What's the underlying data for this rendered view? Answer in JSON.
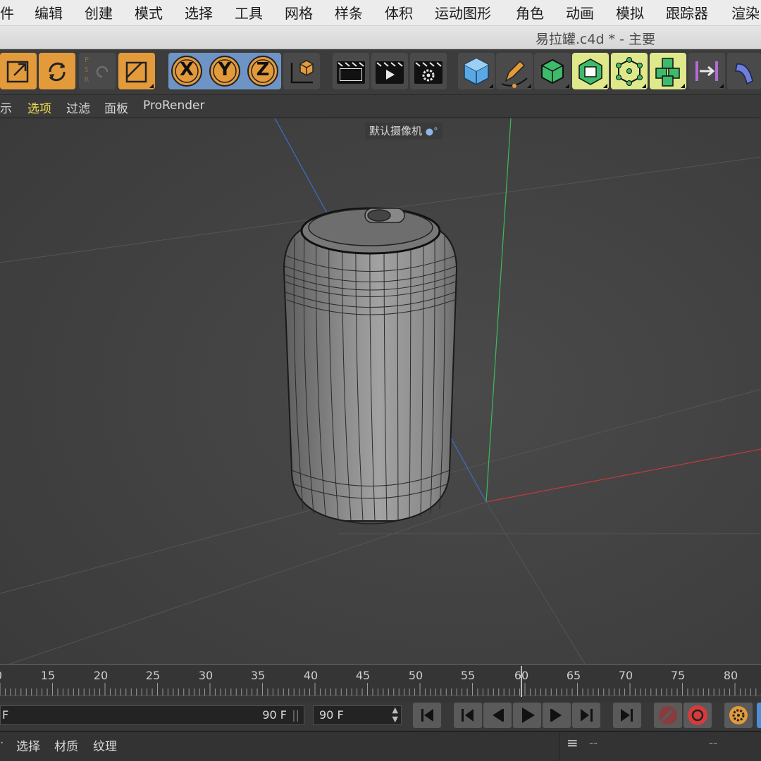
{
  "menu": {
    "items": [
      "件",
      "编辑",
      "创建",
      "模式",
      "选择",
      "工具",
      "网格",
      "样条",
      "体积",
      "运动图形",
      "角色",
      "动画",
      "模拟",
      "跟踪器",
      "渲染"
    ]
  },
  "window": {
    "title": "易拉罐.c4d * - 主要"
  },
  "toolbar": {
    "psr_label": "P S R",
    "axis_x": "X",
    "axis_y": "Y",
    "axis_z": "Z"
  },
  "viewport_menu": {
    "items": [
      "示",
      "选项",
      "过滤",
      "面板",
      "ProRender"
    ],
    "active_item": "选项"
  },
  "viewport": {
    "camera_label": "默认摄像机",
    "object": "soda-can wireframe"
  },
  "timeline": {
    "tick_labels": [
      "0",
      "15",
      "20",
      "25",
      "30",
      "35",
      "40",
      "45",
      "50",
      "55",
      "60",
      "65",
      "70",
      "75",
      "80"
    ],
    "current_frame_marker": "60"
  },
  "playback": {
    "start_field": "F",
    "end_field": "90 F",
    "max_field": "90 F"
  },
  "bottom": {
    "items": [
      "选择",
      "材质",
      "纹理"
    ],
    "right_placeholder_1": "--",
    "right_placeholder_2": "--"
  },
  "colors": {
    "accent_orange": "#e39a3b",
    "active_menu": "#f2e04d",
    "x_axis": "#c23b3b",
    "y_axis": "#3dbb5a",
    "z_axis": "#3a6fc9"
  }
}
